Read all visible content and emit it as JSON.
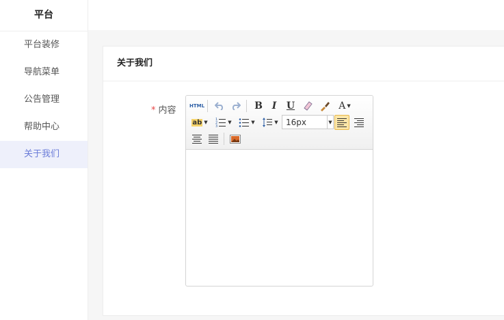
{
  "sidebar": {
    "title": "平台",
    "items": [
      {
        "label": "平台装修"
      },
      {
        "label": "导航菜单"
      },
      {
        "label": "公告管理"
      },
      {
        "label": "帮助中心"
      },
      {
        "label": "关于我们"
      }
    ],
    "active_index": 4
  },
  "card": {
    "title": "关于我们",
    "field_label": "内容",
    "required_mark": "*"
  },
  "editor": {
    "html_label": "HTML",
    "bold_label": "B",
    "italic_label": "I",
    "underline_label": "U",
    "font_color_label": "A",
    "highlight_label": "ab",
    "font_size": "16px",
    "icons": [
      "html-icon",
      "undo-icon",
      "redo-icon",
      "bold-icon",
      "italic-icon",
      "underline-icon",
      "eraser-icon",
      "format-brush-icon",
      "font-color-icon",
      "highlight-icon",
      "ordered-list-icon",
      "unordered-list-icon",
      "line-height-icon",
      "align-left-icon",
      "align-right-icon",
      "align-center-icon",
      "align-justify-icon",
      "image-icon"
    ],
    "content": ""
  },
  "colors": {
    "accent": "#6b7cd8",
    "active_bg": "#eef0fb",
    "required": "#e64545"
  }
}
